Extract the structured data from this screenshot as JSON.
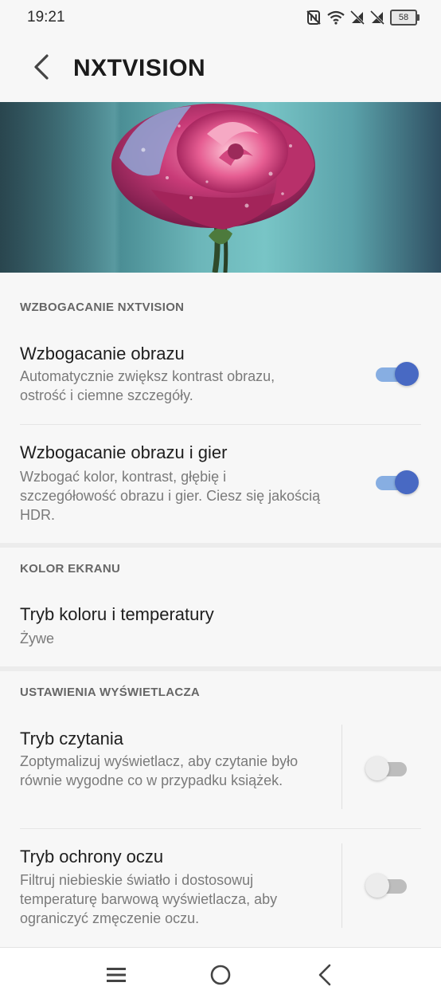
{
  "status_bar": {
    "time": "19:21",
    "battery_level": "58",
    "icons": [
      "nfc-off-icon",
      "wifi-icon",
      "sim1-no-signal-icon",
      "sim2-no-signal-icon",
      "battery-icon"
    ]
  },
  "app_bar": {
    "title": "NXTVISION",
    "back_icon": "back-arrow-icon"
  },
  "hero": {
    "image": "rose-banner"
  },
  "sections": {
    "enhancement": {
      "header": "WZBOGACANIE NXTVISION",
      "items": [
        {
          "title": "Wzbogacanie obrazu",
          "description": "Automatycznie zwiększ kontrast obrazu, ostrość i ciemne szczegóły.",
          "enabled": true
        },
        {
          "title": "Wzbogacanie obrazu i gier",
          "description": "Wzbogać kolor, kontrast, głębię i szczegółowość obrazu i gier. Ciesz się jakością HDR.",
          "enabled": true
        }
      ]
    },
    "screen_color": {
      "header": "KOLOR EKRANU",
      "items": [
        {
          "title": "Tryb koloru i temperatury",
          "value": "Żywe"
        }
      ]
    },
    "display_settings": {
      "header": "USTAWIENIA WYŚWIETLACZA",
      "items": [
        {
          "title": "Tryb czytania",
          "description": "Zoptymalizuj wyświetlacz, aby czytanie było równie wygodne co w przypadku książek.",
          "enabled": false
        },
        {
          "title": "Tryb ochrony oczu",
          "description": "Filtruj niebieskie światło i dostosowuj temperaturę barwową wyświetlacza, aby ograniczyć zmęczenie oczu.",
          "enabled": false
        }
      ]
    }
  },
  "nav_bar": {
    "icons": [
      "menu-icon",
      "home-icon",
      "back-icon"
    ]
  },
  "colors": {
    "accent": "#4869c3",
    "accent_track": "#87aee2",
    "background": "#f7f7f7"
  }
}
